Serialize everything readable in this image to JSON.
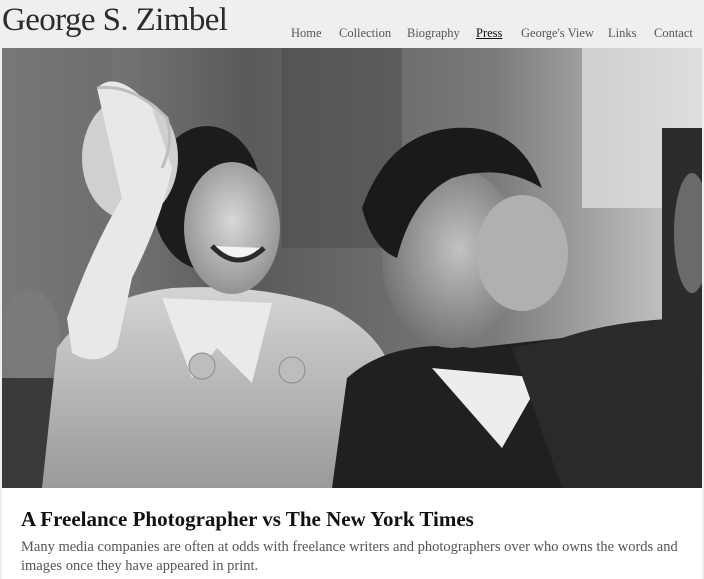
{
  "site": {
    "title": "George S. Zimbel"
  },
  "nav": {
    "items": [
      {
        "label": "Home"
      },
      {
        "label": "Collection"
      },
      {
        "label": "Biography"
      },
      {
        "label": "Press"
      },
      {
        "label": "George's View"
      },
      {
        "label": "Links"
      },
      {
        "label": "Contact"
      }
    ],
    "active": "Press"
  },
  "article": {
    "headline": "A Freelance Photographer vs The New York Times",
    "lede": "Many media companies are often at odds with freelance writers and photographers over who owns the words and images once they have appeared in print."
  }
}
